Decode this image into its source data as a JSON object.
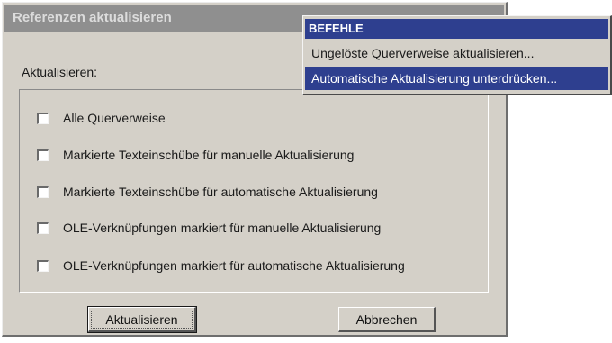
{
  "dialog": {
    "title": "Referenzen aktualisieren",
    "section_label": "Aktualisieren:",
    "options": [
      {
        "label": "Alle Querverweise",
        "checked": false
      },
      {
        "label": "Markierte Texteinschübe für manuelle Aktualisierung",
        "checked": false
      },
      {
        "label": "Markierte Texteinschübe für automatische Aktualisierung",
        "checked": false
      },
      {
        "label": "OLE-Verknüpfungen markiert für manuelle Aktualisierung",
        "checked": false
      },
      {
        "label": "OLE-Verknüpfungen markiert für automatische Aktualisierung",
        "checked": false
      }
    ],
    "buttons": {
      "update": "Aktualisieren",
      "cancel": "Abbrechen"
    }
  },
  "context_menu": {
    "header": "BEFEHLE",
    "items": [
      {
        "label": "Ungelöste Querverweise aktualisieren...",
        "selected": false
      },
      {
        "label": "Automatische Aktualisierung unterdrücken...",
        "selected": true
      }
    ]
  },
  "colors": {
    "highlight": "#2e3f8f",
    "dialog_face": "#d4d0c8",
    "inactive_titlebar": "#8f8f8f"
  }
}
